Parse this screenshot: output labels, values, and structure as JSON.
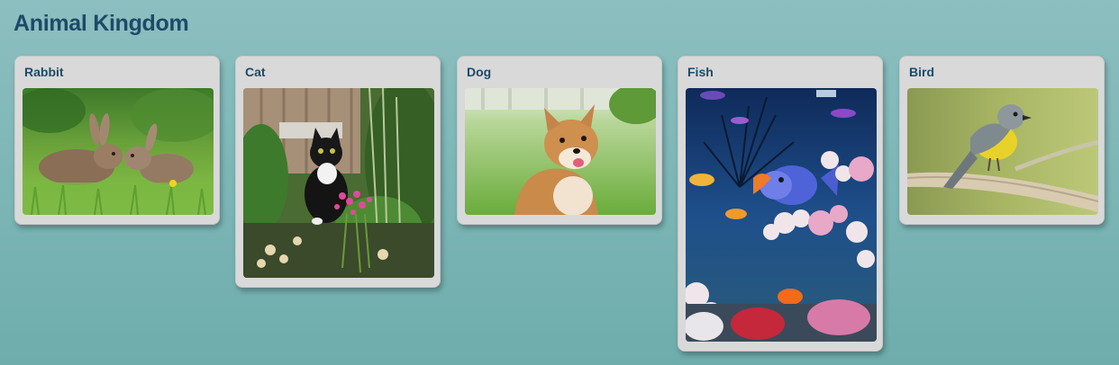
{
  "page": {
    "title": "Animal Kingdom"
  },
  "cards": [
    {
      "name": "Rabbit",
      "image": "rabbits-in-grass-photo"
    },
    {
      "name": "Cat",
      "image": "tuxedo-cat-in-garden-photo"
    },
    {
      "name": "Dog",
      "image": "shiba-inu-dog-photo"
    },
    {
      "name": "Fish",
      "image": "aquarium-fish-photo"
    },
    {
      "name": "Bird",
      "image": "yellow-bird-on-branch-photo"
    }
  ],
  "colors": {
    "title": "#1d4a68",
    "background": "#7ab4b4",
    "card": "#d9d9d9"
  }
}
